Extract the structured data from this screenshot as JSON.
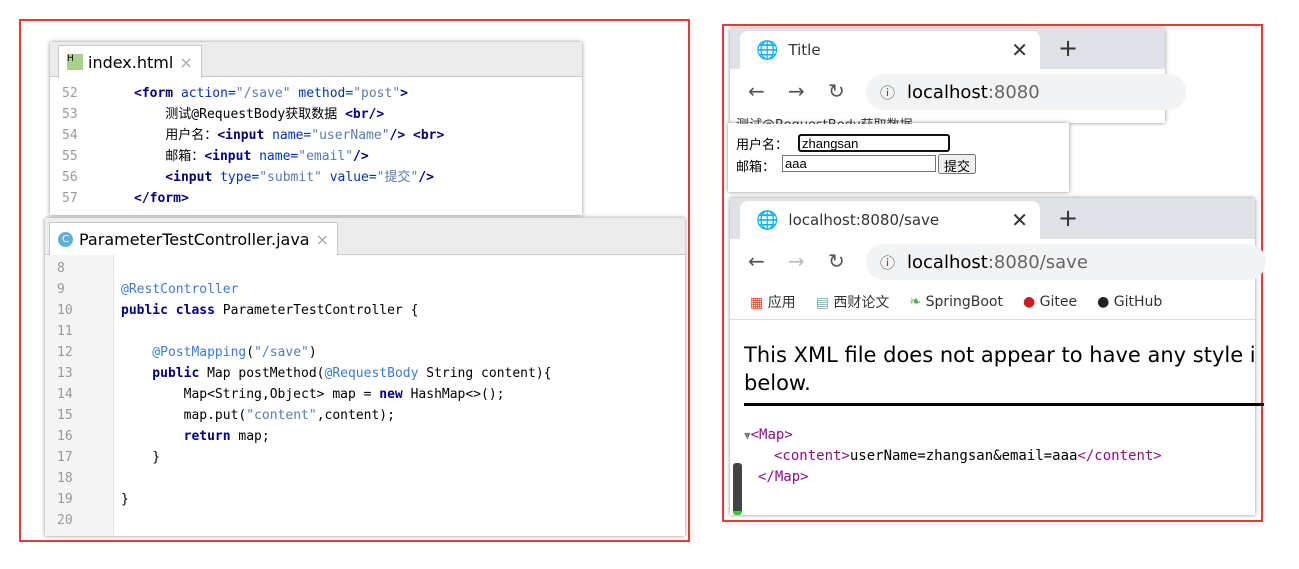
{
  "html_editor": {
    "tab": "index.html",
    "lines": [
      {
        "n": "52",
        "parts": [
          [
            "kw",
            "<form "
          ],
          [
            "at",
            "action="
          ],
          [
            "str",
            "\"/save\" "
          ],
          [
            "at",
            "method="
          ],
          [
            "str",
            "\"post\""
          ],
          [
            "kw",
            ">"
          ]
        ]
      },
      {
        "n": "53",
        "parts": [
          [
            "",
            "    测试@RequestBody获取数据 "
          ],
          [
            "kw",
            "<br/>"
          ]
        ]
      },
      {
        "n": "54",
        "parts": [
          [
            "",
            "    用户名："
          ],
          [
            "kw",
            "<input "
          ],
          [
            "at",
            "name="
          ],
          [
            "str",
            "\"userName\""
          ],
          [
            "kw",
            "/> <br>"
          ]
        ]
      },
      {
        "n": "55",
        "parts": [
          [
            "",
            "    邮箱："
          ],
          [
            "kw",
            "<input "
          ],
          [
            "at",
            "name="
          ],
          [
            "str",
            "\"email\""
          ],
          [
            "kw",
            "/>"
          ]
        ]
      },
      {
        "n": "56",
        "parts": [
          [
            "kw",
            "    <input "
          ],
          [
            "at",
            "type="
          ],
          [
            "str",
            "\"submit\" "
          ],
          [
            "at",
            "value="
          ],
          [
            "str",
            "\"提交\""
          ],
          [
            "kw",
            "/>"
          ]
        ]
      },
      {
        "n": "57",
        "parts": [
          [
            "kw",
            "</form>"
          ]
        ]
      }
    ]
  },
  "java_editor": {
    "tab": "ParameterTestController.java",
    "lines": [
      {
        "n": "8",
        "parts": []
      },
      {
        "n": "9",
        "parts": [
          [
            "ann",
            "@RestController"
          ]
        ]
      },
      {
        "n": "10",
        "parts": [
          [
            "kw",
            "public class "
          ],
          [
            "",
            "ParameterTestController {"
          ]
        ]
      },
      {
        "n": "11",
        "parts": []
      },
      {
        "n": "12",
        "parts": [
          [
            "ann",
            "    @PostMapping"
          ],
          [
            "",
            "("
          ],
          [
            "str",
            "\"/save\""
          ],
          [
            "",
            ")"
          ]
        ]
      },
      {
        "n": "13",
        "parts": [
          [
            "kw",
            "    public "
          ],
          [
            "",
            "Map postMethod("
          ],
          [
            "ann",
            "@RequestBody "
          ],
          [
            "",
            "String content){"
          ]
        ]
      },
      {
        "n": "14",
        "parts": [
          [
            "",
            "        Map<String,Object> map = "
          ],
          [
            "kw",
            "new "
          ],
          [
            "",
            "HashMap<>();"
          ]
        ]
      },
      {
        "n": "15",
        "parts": [
          [
            "",
            "        map.put("
          ],
          [
            "str",
            "\"content\""
          ],
          [
            "",
            ",content);"
          ]
        ]
      },
      {
        "n": "16",
        "parts": [
          [
            "kw",
            "        return "
          ],
          [
            "",
            "map;"
          ]
        ]
      },
      {
        "n": "17",
        "parts": [
          [
            "",
            "    }"
          ]
        ]
      },
      {
        "n": "18",
        "parts": []
      },
      {
        "n": "19",
        "parts": [
          [
            "",
            "}"
          ]
        ]
      },
      {
        "n": "20",
        "parts": []
      }
    ]
  },
  "browser1": {
    "tab_title": "Title",
    "url_host": "localhost",
    "url_rest": ":8080",
    "form": {
      "heading": "测试@RequestBody获取数据",
      "username_label": "用户名：",
      "username_value": "zhangsan",
      "email_label": "邮箱：",
      "email_value": "aaa",
      "submit": "提交"
    }
  },
  "browser2": {
    "tab_title": "localhost:8080/save",
    "url_host": "localhost",
    "url_rest": ":8080/save",
    "bookmarks": [
      "应用",
      "西财论文",
      "SpringBoot",
      "Gitee",
      "GitHub"
    ],
    "notice": "This XML file does not appear to have any style i below.",
    "xml": {
      "open": "<Map>",
      "content_open": "<content>",
      "content_value": "userName=zhangsan&email=aaa",
      "content_close": "</content>",
      "close": "</Map>"
    }
  },
  "colors": {
    "frame": "#e83a3a",
    "tag": "#881280"
  }
}
